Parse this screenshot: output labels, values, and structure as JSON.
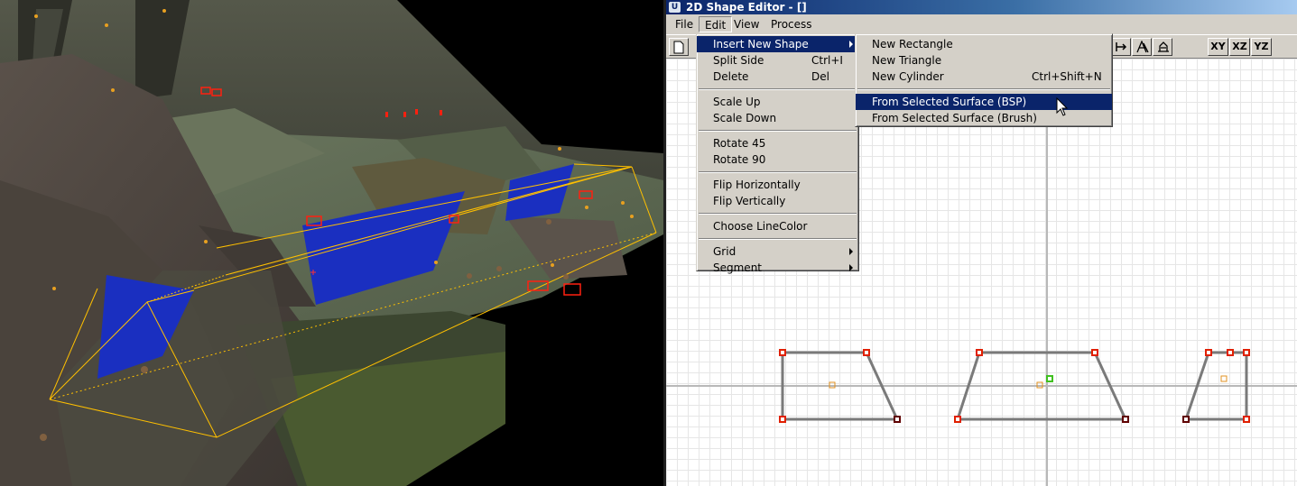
{
  "window": {
    "title": "2D Shape Editor - []",
    "icon": "unreal-icon"
  },
  "menubar": [
    "File",
    "Edit",
    "View",
    "Process"
  ],
  "toolbar": {
    "axis_buttons": [
      "XY",
      "XZ",
      "YZ"
    ],
    "icons": [
      "new-document-icon",
      "flip-icon",
      "extrude-icon",
      "revolve-icon",
      "bevel-icon"
    ]
  },
  "edit_menu": [
    {
      "label": "Insert New Shape",
      "submenu": true,
      "highlighted": true
    },
    {
      "label": "Split Side",
      "shortcut": "Ctrl+I"
    },
    {
      "label": "Delete",
      "shortcut": "Del"
    },
    {
      "label": "Scale Up"
    },
    {
      "label": "Scale Down"
    },
    {
      "label": "Rotate 45"
    },
    {
      "label": "Rotate 90"
    },
    {
      "label": "Flip Horizontally"
    },
    {
      "label": "Flip Vertically"
    },
    {
      "label": "Choose LineColor"
    },
    {
      "label": "Grid",
      "submenu": true
    },
    {
      "label": "Segment",
      "submenu": true
    }
  ],
  "insert_submenu": [
    {
      "label": "New Rectangle"
    },
    {
      "label": "New Triangle"
    },
    {
      "label": "New Cylinder",
      "shortcut": "Ctrl+Shift+N"
    },
    {
      "label": "From Selected Surface (BSP)",
      "highlighted": true
    },
    {
      "label": "From Selected Surface (Brush)"
    }
  ],
  "colors": {
    "menu_highlight": "#0a246a",
    "vertex": "#e02000",
    "selected_vertex": "#40c020",
    "pivot": "#e09020",
    "edge": "#7a7a7a",
    "brush_wire": "#ffc000",
    "selected_surface": "#1020c0"
  }
}
